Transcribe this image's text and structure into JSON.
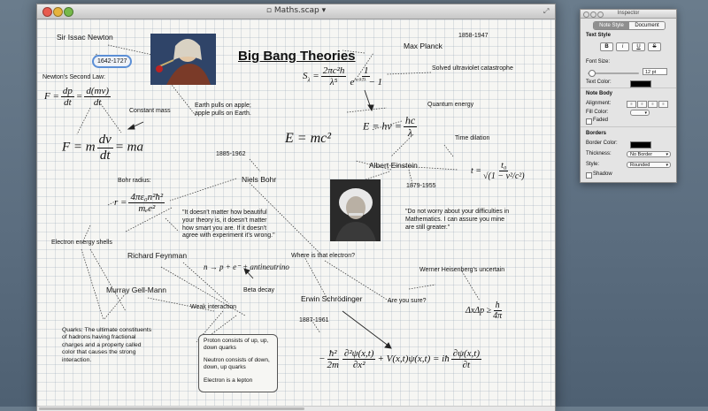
{
  "window": {
    "title": "Maths.scap",
    "title_caret": "▾",
    "fullscreen_glyph": "⤢"
  },
  "canvas": {
    "title": "Big Bang Theories",
    "notes": {
      "newton": "Sir Issac Newton",
      "newton_years": "1642-1727",
      "second_law": "Newton's Second Law:",
      "constant_mass": "Constant mass",
      "earth_apple": "Earth pulls on apple; apple pulls on Earth.",
      "planck": "Max Planck",
      "planck_years": "1858-1947",
      "uv_catastrophe": "Solved ultraviolet catastrophe",
      "quantum_energy": "Quantum energy",
      "time_dilation": "Time dilation",
      "einstein": "Albert Einstein",
      "einstein_years": "1879-1955",
      "einstein_quote": "\"Do not worry about your difficulties in Mathematics. I can assure you mine are still greater.\"",
      "bohr_years": "1885-1962",
      "bohr": "Niels Bohr",
      "bohr_radius": "Bohr radius:",
      "feynman_quote": "\"It doesn't matter how beautiful your theory is, it doesn't matter how smart you are. If it doesn't agree with experiment it's wrong.\"",
      "electron_shells": "Electron energy shells",
      "feynman": "Richard Feynman",
      "beta_decay": "Beta decay",
      "gellmann": "Murray Gell-Mann",
      "weak_interaction": "Weak interaction",
      "where_electron": "Where is that electron?",
      "heisenberg": "Werner Heisenberg's uncertain",
      "schrodinger": "Erwin Schrödinger",
      "are_you_sure": "Are you sure?",
      "schrodinger_years": "1887-1961",
      "quarks": "Quarks: The ultimate constituents of hadrons having fractional charges and a property called color that causes the strong interaction.",
      "proton": "Proton consists of up, up, down quarks",
      "neutron": "Neutron consists of down, down, up quarks",
      "electron": "Electron is a lepton"
    },
    "math": {
      "emc2": "E = mc²",
      "beta_eq": "n → p + e⁻ + antineutrino",
      "f_eq_left": "F = ",
      "f_eq_right": "= ma",
      "heis_left": "ΔxΔp ≥"
    }
  },
  "inspector": {
    "title": "Inspector",
    "tabs": [
      "Note Style",
      "Document"
    ],
    "text_style_label": "Text Style",
    "buttons": [
      "B",
      "i",
      "U",
      "S"
    ],
    "font_size_label": "Font Size:",
    "font_size_value": "12 pt",
    "text_color_label": "Text Color:",
    "note_body_label": "Note Body",
    "alignment_label": "Alignment:",
    "fill_color_label": "Fill Color:",
    "faded_label": "Faded",
    "borders_label": "Borders",
    "border_color_label": "Border Color:",
    "thickness_label": "Thickness:",
    "thickness_value": "No Border",
    "style_label": "Style:",
    "style_value": "Rounded",
    "shadow_label": "Shadow"
  }
}
